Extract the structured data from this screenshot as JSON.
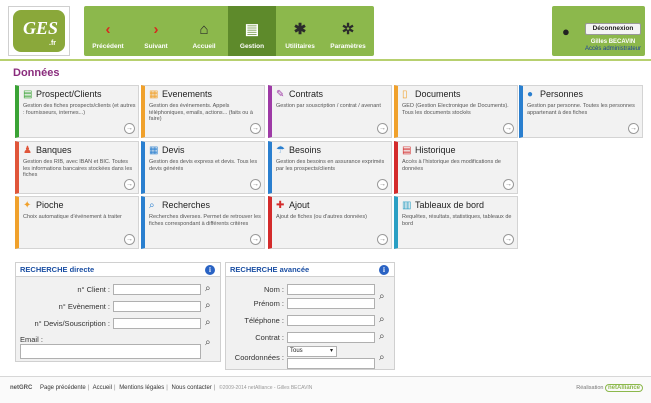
{
  "logo": {
    "text": "GES",
    "suffix": ".fr"
  },
  "nav": {
    "items": [
      {
        "label": "Précédent",
        "icon": "‹",
        "icon_name": "chevron-left-icon"
      },
      {
        "label": "Suivant",
        "icon": "›",
        "icon_name": "chevron-right-icon"
      },
      {
        "label": "Accueil",
        "icon": "⌂",
        "icon_name": "home-icon"
      },
      {
        "label": "Gestion",
        "icon": "▤",
        "icon_name": "gestion-icon"
      },
      {
        "label": "Utilitaires",
        "icon": "✱",
        "icon_name": "utilities-icon"
      },
      {
        "label": "Paramètres",
        "icon": "✲",
        "icon_name": "settings-icon"
      }
    ],
    "active": "Gestion"
  },
  "user": {
    "disconnect_label": "Déconnexion",
    "name": "Gilles BECAVIN",
    "role": "Accès administrateur"
  },
  "page": {
    "title": "Données"
  },
  "tiles": [
    {
      "title": "Prospect/Clients",
      "desc": "Gestion des fiches prospects/clients (et autres : fournisseurs, internes...)",
      "color": "#3aa335",
      "icon": "▤",
      "icon_name": "prospect-icon"
    },
    {
      "title": "Evenements",
      "desc": "Gestion des événements. Appels téléphoniques, emails, actions... (faits ou à faire)",
      "color": "#f0a12c",
      "icon": "▦",
      "icon_name": "events-icon"
    },
    {
      "title": "Contrats",
      "desc": "Gestion par souscription / contrat / avenant",
      "color": "#9e3aa6",
      "icon": "✎",
      "icon_name": "contracts-icon"
    },
    {
      "title": "Documents",
      "desc": "GED (Gestion Electronique de Documents). Tous les documents stockés",
      "color": "#f0a12c",
      "icon": "▯",
      "icon_name": "documents-icon"
    },
    {
      "title": "Personnes",
      "desc": "Gestion par personne. Toutes les personnes appartenant à des fiches",
      "color": "#2a7fcf",
      "icon": "●",
      "icon_name": "person-icon"
    },
    {
      "title": "Banques",
      "desc": "Gestion des RIB, avec IBAN et BIC. Toutes les informations bancaires stockées dans les fiches",
      "color": "#e0563a",
      "icon": "♟",
      "icon_name": "bank-icon"
    },
    {
      "title": "Devis",
      "desc": "Gestion des devis express et devis. Tous les devis générés",
      "color": "#2a7fcf",
      "icon": "▦",
      "icon_name": "quote-icon"
    },
    {
      "title": "Besoins",
      "desc": "Gestion des besoins en assurance exprimés par les prospects/clients",
      "color": "#2a7fcf",
      "icon": "☂",
      "icon_name": "needs-icon"
    },
    {
      "title": "Historique",
      "desc": "Accès à l'historique des modifications de données",
      "color": "#d42b2b",
      "icon": "▤",
      "icon_name": "history-icon"
    },
    {
      "title": "Pioche",
      "desc": "Choix automatique d'événement à traiter",
      "color": "#f0a12c",
      "icon": "✦",
      "icon_name": "draw-icon"
    },
    {
      "title": "Recherches",
      "desc": "Recherches diverses. Permet de retrouver les fiches correspondant à différents critères",
      "color": "#2a7fcf",
      "icon": "⌕",
      "icon_name": "search-icon"
    },
    {
      "title": "Ajout",
      "desc": "Ajout de fiches (ou d'autres données)",
      "color": "#d42b2b",
      "icon": "✚",
      "icon_name": "add-icon"
    },
    {
      "title": "Tableaux de bord",
      "desc": "Requêtes, résultats, statistiques, tableaux de bord",
      "color": "#2a9fc4",
      "icon": "▥",
      "icon_name": "dashboard-icon"
    }
  ],
  "tile_arrow": "→",
  "search_direct": {
    "title": "RECHERCHE directe",
    "info": "i",
    "fields": [
      {
        "label": "n° Client :"
      },
      {
        "label": "n° Evènement :"
      },
      {
        "label": "n° Devis/Souscription :"
      },
      {
        "label": "Email :"
      }
    ]
  },
  "search_advanced": {
    "title": "RECHERCHE avancée",
    "info": "i",
    "fields": [
      {
        "label": "Nom :"
      },
      {
        "label": "Prénom :"
      },
      {
        "label": "Téléphone :"
      },
      {
        "label": "Contrat :"
      },
      {
        "label": "Coordonnées :"
      }
    ],
    "coord_select": "Tous"
  },
  "search_button_icon": "⌕",
  "footer": {
    "logo": "netGRC",
    "links": [
      "Page précédente",
      "Accueil",
      "Mentions légales",
      "Nous contacter"
    ],
    "copyright": "©2009-2014 netAlliance - Gilles BECAVIN",
    "realisation": "Réalisation",
    "brand": "netAlliance"
  }
}
